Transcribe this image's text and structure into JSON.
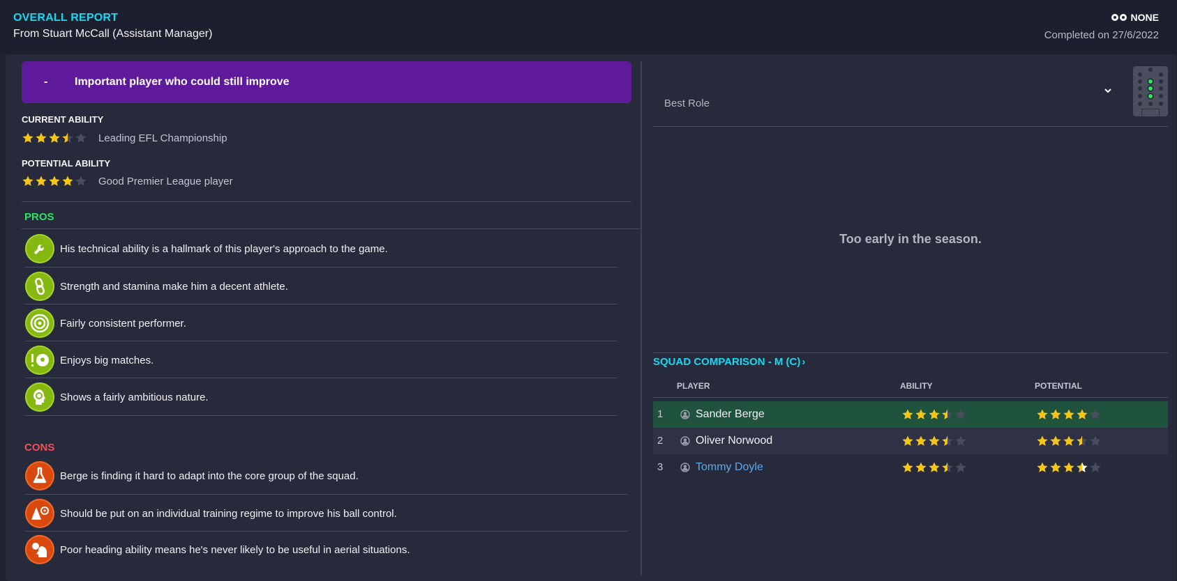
{
  "header": {
    "title": "OVERALL REPORT",
    "from": "From Stuart McCall (Assistant Manager)",
    "scout_status": "NONE",
    "completed": "Completed on 27/6/2022"
  },
  "banner": {
    "dash": "-",
    "text": "Important player who could still improve",
    "color": "#5f1a9c"
  },
  "current_ability": {
    "label": "CURRENT ABILITY",
    "stars": 3.5,
    "description": "Leading EFL Championship"
  },
  "potential_ability": {
    "label": "POTENTIAL ABILITY",
    "stars": 4,
    "description": "Good Premier League player"
  },
  "pros": {
    "title": "PROS",
    "color": "#2ee36a",
    "items": [
      {
        "icon": "wrench-icon",
        "text": "His technical ability is a hallmark of this player's approach to the game."
      },
      {
        "icon": "chain-icon",
        "text": "Strength and stamina make him a decent athlete."
      },
      {
        "icon": "target-icon",
        "text": "Fairly consistent performer."
      },
      {
        "icon": "ball-exclaim-icon",
        "text": "Enjoys big matches."
      },
      {
        "icon": "head-icon",
        "text": "Shows a fairly ambitious nature."
      }
    ]
  },
  "cons": {
    "title": "CONS",
    "color": "#f2505a",
    "items": [
      {
        "icon": "flask-icon",
        "text": "Berge is finding it hard to adapt into the core group of the squad."
      },
      {
        "icon": "cone-target-icon",
        "text": "Should be put on an individual training regime to improve his ball control."
      },
      {
        "icon": "header-ball-icon",
        "text": "Poor heading ability means he's never likely to be useful in aerial situations."
      }
    ]
  },
  "role": {
    "label": "Best Role",
    "message": "Too early in the season."
  },
  "squad": {
    "title": "SQUAD COMPARISON - M (C)",
    "title_arrow": "›",
    "columns": {
      "player": "PLAYER",
      "ability": "ABILITY",
      "potential": "POTENTIAL"
    },
    "rows": [
      {
        "num": "1",
        "name": "Sander Berge",
        "ability": 3.5,
        "potential": 4,
        "selected": true,
        "link": false
      },
      {
        "num": "2",
        "name": "Oliver Norwood",
        "ability": 3.5,
        "potential": 3.5,
        "selected": false,
        "link": false
      },
      {
        "num": "3",
        "name": "Tommy Doyle",
        "ability": 3.5,
        "potential": 3.5,
        "potential_range": 4.5,
        "selected": false,
        "link": true
      }
    ]
  },
  "colors": {
    "accent": "#19d8f0",
    "star": "#f5c518",
    "star_empty": "#4a4d5c"
  }
}
